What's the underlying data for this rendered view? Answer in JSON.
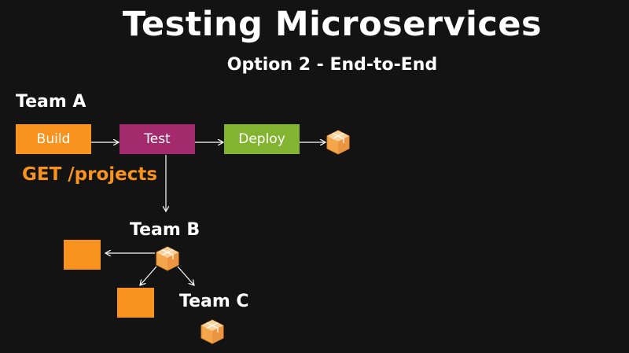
{
  "slide": {
    "title": "Testing Microservices",
    "subtitle": "Option 2 - End-to-End"
  },
  "team_a": {
    "label": "Team A",
    "steps": [
      "Build",
      "Test",
      "Deploy"
    ],
    "step_colors": [
      "#f7931e",
      "#a32a6c",
      "#82b432"
    ]
  },
  "request": {
    "text": "GET /projects",
    "color": "#f7931e"
  },
  "team_b": {
    "label": "Team B"
  },
  "team_c": {
    "label": "Team C"
  },
  "icons": {
    "artifact": "package-box-icon"
  }
}
